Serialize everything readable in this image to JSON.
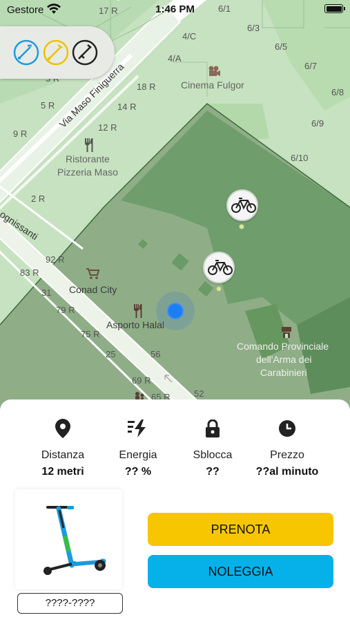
{
  "status_bar": {
    "carrier": "Gestore",
    "time": "1:46 PM"
  },
  "filters": [
    {
      "icon": "scooter-filter-icon",
      "color": "#1a9be0"
    },
    {
      "icon": "moped-filter-icon",
      "color": "#f0c000"
    },
    {
      "icon": "bike-filter-icon",
      "color": "#222222"
    }
  ],
  "map": {
    "roads": [
      "Via Maso Finiguerra",
      "ognissanti"
    ],
    "pois": {
      "cinema": "Cinema Fulgor",
      "restaurant_1": "Ristorante",
      "restaurant_2": "Pizzeria Maso",
      "supermarket": "Conad City",
      "takeaway": "Asporto Halal",
      "carabinieri_1": "Comando Provinciale",
      "carabinieri_2": "dell'Arma dei",
      "carabinieri_3": "Carabinieri"
    },
    "house_numbers": {
      "n17r": "17 R",
      "n6_1": "6/1",
      "n6_3": "6/3",
      "n4c": "4/C",
      "n6_5": "6/5",
      "n4a": "4/A",
      "n6_7": "6/7",
      "n3r": "3 R",
      "n18r": "18 R",
      "n6_8": "6/8",
      "n5r": "5 R",
      "n14r": "14 R",
      "n6_9": "6/9",
      "n9r": "9 R",
      "n12r": "12 R",
      "n6_10": "6/10",
      "n2r": "2 R",
      "n92r": "92 R",
      "n83r": "83 R",
      "n31": "31",
      "n79r": "79 R",
      "n75r": "75 R",
      "n25": "25",
      "n56": "56",
      "n69r": "69 R",
      "n65r": "65 R",
      "n52": "52"
    }
  },
  "vehicle": {
    "stats": [
      {
        "icon": "location-pin-icon",
        "label": "Distanza",
        "value": "12 metri"
      },
      {
        "icon": "energy-icon",
        "label": "Energia",
        "value": "?? %"
      },
      {
        "icon": "lock-icon",
        "label": "Sblocca",
        "value": "??"
      },
      {
        "icon": "clock-icon",
        "label": "Prezzo",
        "value": "??al minuto"
      }
    ],
    "code": "????-????",
    "book_label": "PRENOTA",
    "rent_label": "NOLEGGIA"
  },
  "colors": {
    "accent_yellow": "#f7c600",
    "accent_blue": "#05b1e8",
    "map_park": "#c5e3bf",
    "map_zone": "#8fae88",
    "map_zone_dark": "#6c9a69",
    "user_location": "#1c7ef2"
  }
}
